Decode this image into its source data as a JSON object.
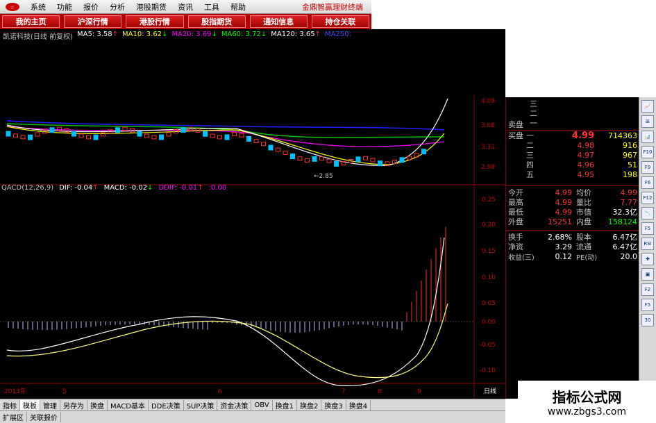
{
  "menu": {
    "items": [
      "系统",
      "功能",
      "报价",
      "分析",
      "港股期货",
      "资讯",
      "工具",
      "帮助"
    ],
    "brand": "金鼎智赢理财终端"
  },
  "tabs": [
    "我的主页",
    "沪深行情",
    "港股行情",
    "股指期货",
    "通知信息",
    "持仓关联"
  ],
  "chart_title": "凯诺科技(日线 前复权)",
  "ma": [
    {
      "label": "MA5: 3.58",
      "arrow": "↑",
      "color": "#ffffff"
    },
    {
      "label": "MA10: 3.62",
      "arrow": "↓",
      "color": "#ffff00"
    },
    {
      "label": "MA20: 3.69",
      "arrow": "↓",
      "color": "#ff00ff"
    },
    {
      "label": "MA60: 3.72",
      "arrow": "↓",
      "color": "#00ff00"
    },
    {
      "label": "MA120: 3.65",
      "arrow": "↑",
      "color": "#ffffff"
    },
    {
      "label": "MA250:",
      "arrow": "",
      "color": "#0000ff"
    }
  ],
  "price_axis": [
    "4.09",
    "3.68",
    "3.31",
    "2.98"
  ],
  "low_marker": "←2.85",
  "macd": {
    "title": "QACD(12,26,9)",
    "dif": "DIF: -0.04",
    "dif_arrow": "↑",
    "macd": "MACD: -0.02",
    "macd_arrow": "↓",
    "ddif": "DDIF: -0.01",
    "ddif_arrow": "↑",
    "extra": ":0.00",
    "axis": [
      "0.25",
      "0.20",
      "0.15",
      "0.10",
      "0.05",
      "0.00",
      "-0.05",
      "-0.10"
    ]
  },
  "time_axis": {
    "year": "2013年",
    "months": [
      "5",
      "6",
      "7",
      "8",
      "9"
    ],
    "period": "日线"
  },
  "order_book": {
    "sell_label": "卖盘",
    "sell_rows": [
      {
        "lvl": "三",
        "p": "",
        "v": ""
      },
      {
        "lvl": "二",
        "p": "",
        "v": ""
      },
      {
        "lvl": "一",
        "p": "",
        "v": ""
      }
    ],
    "buy_label": "买盘",
    "buy_rows": [
      {
        "lvl": "一",
        "p": "4.99",
        "v": "714363"
      },
      {
        "lvl": "二",
        "p": "4.98",
        "v": "916"
      },
      {
        "lvl": "三",
        "p": "4.97",
        "v": "967"
      },
      {
        "lvl": "四",
        "p": "4.96",
        "v": "51"
      },
      {
        "lvl": "五",
        "p": "4.95",
        "v": "198"
      }
    ]
  },
  "stats": [
    {
      "l1": "今开",
      "v1": "4.99",
      "l2": "均价",
      "v2": "4.99",
      "c1": "#ff3030",
      "c2": "#ff3030"
    },
    {
      "l1": "最高",
      "v1": "4.99",
      "l2": "量比",
      "v2": "7.77",
      "c1": "#ff3030",
      "c2": "#ff3030"
    },
    {
      "l1": "最低",
      "v1": "4.99",
      "l2": "市值",
      "v2": "32.3亿",
      "c1": "#ff3030",
      "c2": "#ffffff"
    },
    {
      "l1": "外盘",
      "v1": "15251",
      "l2": "内盘",
      "v2": "158124",
      "c1": "#ff3030",
      "c2": "#00ff00"
    }
  ],
  "stats2": [
    {
      "l1": "换手",
      "v1": "2.68%",
      "l2": "股本",
      "v2": "6.47亿"
    },
    {
      "l1": "净资",
      "v1": "3.29",
      "l2": "流通",
      "v2": "6.47亿"
    },
    {
      "l1": "收益(三)",
      "v1": "0.12",
      "l2": "PE(动)",
      "v2": "20.0"
    }
  ],
  "bottom_tabs": [
    "指标",
    "模板",
    "管理",
    "另存为",
    "换盘",
    "MACD基本",
    "DDE决策",
    "SUP决策",
    "资金决策",
    "OBV",
    "换盘1",
    "换盘2",
    "换盘3",
    "换盘4"
  ],
  "status_tabs": [
    "扩展区",
    "关联报价"
  ],
  "toolbar_buttons": [
    "📈",
    "⊞",
    "📊",
    "F10",
    "F9",
    "F6",
    "F12",
    "📉",
    "F5",
    "RSI",
    "✚",
    "▣",
    "F2",
    "F5",
    "30"
  ],
  "watermark": {
    "title": "指标公式网",
    "url": "www.zbgs3.com"
  }
}
